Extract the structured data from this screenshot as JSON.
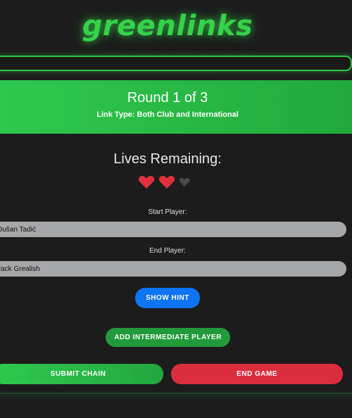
{
  "app": {
    "logo_text": "greenlinks"
  },
  "progress": {
    "fraction": 0.0
  },
  "round": {
    "title": "Round 1 of 3",
    "link_type": "Link Type: Both Club and International"
  },
  "lives": {
    "title": "Lives Remaining:",
    "remaining": 2,
    "total": 3,
    "full_color": "#e0303e",
    "empty_color": "#4a4a4a"
  },
  "start_player": {
    "label": "Start Player:",
    "value": "Dušan Tadić"
  },
  "end_player": {
    "label": "End Player:",
    "value": "Jack Grealish"
  },
  "buttons": {
    "hint": "SHOW HINT",
    "add_intermediate": "ADD INTERMEDIATE PLAYER",
    "submit": "SUBMIT CHAIN",
    "end": "END GAME"
  },
  "colors": {
    "accent_green": "#2fc446",
    "hint_blue": "#0d74f3",
    "end_red": "#da2e3e",
    "background": "#1c1c1c"
  }
}
